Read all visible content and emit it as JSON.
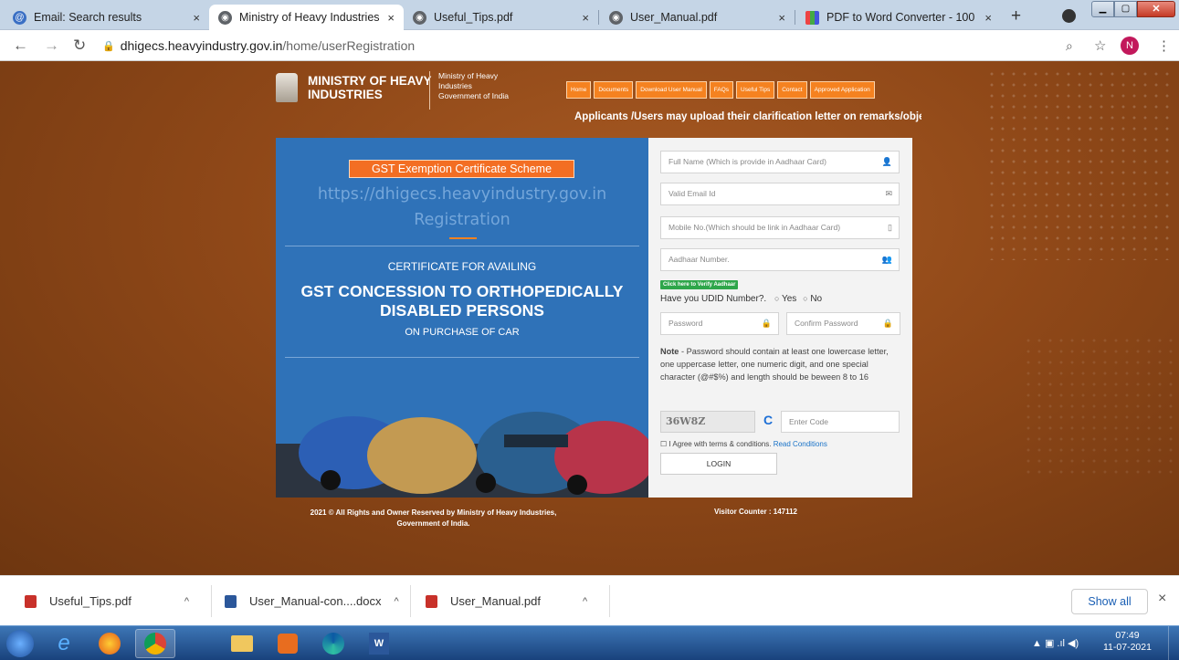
{
  "browser": {
    "tabs": [
      {
        "title": "Email: Search results",
        "active": false
      },
      {
        "title": "Ministry of Heavy Industries",
        "active": true
      },
      {
        "title": "Useful_Tips.pdf",
        "active": false
      },
      {
        "title": "User_Manual.pdf",
        "active": false
      },
      {
        "title": "PDF to Word Converter - 100",
        "active": false
      }
    ],
    "new_tab": "+",
    "close_glyph": "×",
    "url_host": "dhigecs.heavyindustry.gov.in",
    "url_path": "/home/userRegistration",
    "profile_initial": "N"
  },
  "header": {
    "ministry_title_line1": "MINISTRY OF HEAVY",
    "ministry_title_line2": "INDUSTRIES",
    "subtitle_line1": "Ministry of Heavy",
    "subtitle_line2": "Industries",
    "subtitle_line3": "Government of India",
    "menu": [
      "Home",
      "Documents",
      "Download User Manual",
      "FAQs",
      "Useful Tips",
      "Contact",
      "Approved Application"
    ],
    "ticker": "Applicants /Users may upload their clarification letter on remarks/objection raise"
  },
  "banner": {
    "scheme_label": "GST Exemption Certificate Scheme",
    "site_url": "https://dhigecs.heavyindustry.gov.in",
    "site_action": "Registration",
    "cert_line1": "CERTIFICATE FOR AVAILING",
    "cert_line2a": "GST CONCESSION TO ORTHOPEDICALLY",
    "cert_line2b": "DISABLED PERSONS",
    "cert_line3": "ON PURCHASE OF CAR"
  },
  "form": {
    "full_name_placeholder": "Full Name (Which is provide in Aadhaar Card)",
    "email_placeholder": "Valid Email Id",
    "mobile_placeholder": "Mobile No.(Which should be link in Aadhaar Card)",
    "aadhaar_placeholder": "Aadhaar Number.",
    "verify_aadhaar": "Click here to Verify Aadhaar",
    "udid_question": "Have you UDID Number?.",
    "udid_yes": "Yes",
    "udid_no": "No",
    "password_placeholder": "Password",
    "confirm_password_placeholder": "Confirm Password",
    "note_label": "Note",
    "note_text": " - Password should contain at least one lowercase letter, one uppercase letter, one numeric digit, and one special character (@#$%) and length should be beween 8 to 16",
    "captcha_text": "36W8Z",
    "captcha_input_placeholder": "Enter Code",
    "agree_text": "I Agree with terms & conditions.",
    "read_conditions": "Read Conditions",
    "login_label": "LOGIN"
  },
  "footer": {
    "copyright_line1": "2021 © All Rights and Owner Reserved by Ministry of Heavy Industries,",
    "copyright_line2": "Government of India.",
    "visitor_counter": "Visitor Counter : 147112"
  },
  "downloads": {
    "items": [
      "Useful_Tips.pdf",
      "User_Manual-con....docx",
      "User_Manual.pdf"
    ],
    "show_all": "Show all"
  },
  "taskbar": {
    "time": "07:49",
    "date": "11-07-2021"
  },
  "colors": {
    "accent_orange": "#f58220",
    "banner_blue": "#2f72b8",
    "page_brown": "#8f4818"
  }
}
